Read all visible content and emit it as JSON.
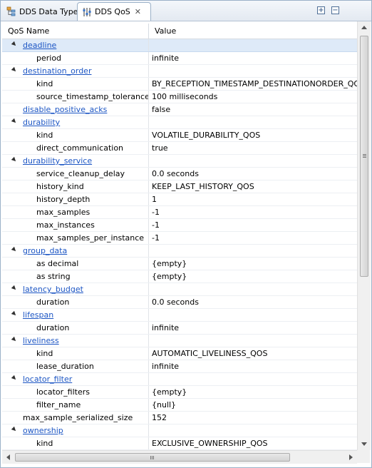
{
  "tabs": [
    {
      "label": "DDS Data Type",
      "icon": "data-type-icon",
      "active": false
    },
    {
      "label": "DDS QoS",
      "icon": "qos-sliders-icon",
      "active": true,
      "close": "✕"
    }
  ],
  "view_buttons": [
    {
      "icon": "expand-all-icon",
      "glyph": "+"
    },
    {
      "icon": "collapse-all-icon",
      "glyph": "−"
    }
  ],
  "columns": {
    "name": "QoS Name",
    "value": "Value"
  },
  "colors": {
    "link": "#1d56c4",
    "selection": "#deeaf8"
  },
  "rows": [
    {
      "name": "deadline",
      "value": "",
      "level": 0,
      "expandable": true,
      "link": true,
      "selected": true
    },
    {
      "name": "period",
      "value": "infinite",
      "level": 1
    },
    {
      "name": "destination_order",
      "value": "",
      "level": 0,
      "expandable": true,
      "link": true
    },
    {
      "name": "kind",
      "value": "BY_RECEPTION_TIMESTAMP_DESTINATIONORDER_QOS",
      "level": 1
    },
    {
      "name": "source_timestamp_tolerance",
      "value": "100 milliseconds",
      "level": 1
    },
    {
      "name": "disable_positive_acks",
      "value": "false",
      "level": 0,
      "link": true
    },
    {
      "name": "durability",
      "value": "",
      "level": 0,
      "expandable": true,
      "link": true
    },
    {
      "name": "kind",
      "value": "VOLATILE_DURABILITY_QOS",
      "level": 1
    },
    {
      "name": "direct_communication",
      "value": "true",
      "level": 1
    },
    {
      "name": "durability_service",
      "value": "",
      "level": 0,
      "expandable": true,
      "link": true
    },
    {
      "name": "service_cleanup_delay",
      "value": "0.0 seconds",
      "level": 1
    },
    {
      "name": "history_kind",
      "value": "KEEP_LAST_HISTORY_QOS",
      "level": 1
    },
    {
      "name": "history_depth",
      "value": "1",
      "level": 1
    },
    {
      "name": "max_samples",
      "value": "-1",
      "level": 1
    },
    {
      "name": "max_instances",
      "value": "-1",
      "level": 1
    },
    {
      "name": "max_samples_per_instance",
      "value": "-1",
      "level": 1
    },
    {
      "name": "group_data",
      "value": "",
      "level": 0,
      "expandable": true,
      "link": true
    },
    {
      "name": "as decimal",
      "value": "{empty}",
      "level": 1
    },
    {
      "name": "as string",
      "value": "{empty}",
      "level": 1
    },
    {
      "name": "latency_budget",
      "value": "",
      "level": 0,
      "expandable": true,
      "link": true
    },
    {
      "name": "duration",
      "value": "0.0 seconds",
      "level": 1
    },
    {
      "name": "lifespan",
      "value": "",
      "level": 0,
      "expandable": true,
      "link": true
    },
    {
      "name": "duration",
      "value": "infinite",
      "level": 1
    },
    {
      "name": "liveliness",
      "value": "",
      "level": 0,
      "expandable": true,
      "link": true
    },
    {
      "name": "kind",
      "value": "AUTOMATIC_LIVELINESS_QOS",
      "level": 1
    },
    {
      "name": "lease_duration",
      "value": "infinite",
      "level": 1
    },
    {
      "name": "locator_filter",
      "value": "",
      "level": 0,
      "expandable": true,
      "link": true
    },
    {
      "name": "locator_filters",
      "value": "{empty}",
      "level": 1
    },
    {
      "name": "filter_name",
      "value": "{null}",
      "level": 1
    },
    {
      "name": "max_sample_serialized_size",
      "value": "152",
      "level": 0
    },
    {
      "name": "ownership",
      "value": "",
      "level": 0,
      "expandable": true,
      "link": true
    },
    {
      "name": "kind",
      "value": "EXCLUSIVE_OWNERSHIP_QOS",
      "level": 1
    }
  ]
}
